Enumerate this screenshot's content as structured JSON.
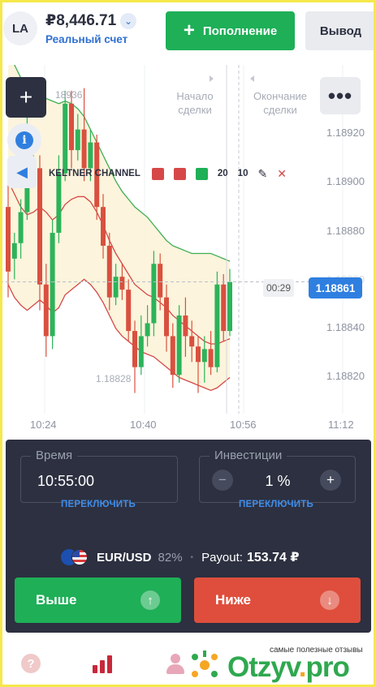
{
  "header": {
    "avatar_initials": "LA",
    "balance": "₽8,446.71",
    "account_type": "Реальный счет",
    "deposit_label": "Пополнение",
    "withdraw_label": "Вывод"
  },
  "chart": {
    "deal_start_label": "Начало\nсделки",
    "deal_end_label": "Окончание\nсделки",
    "current_price": "1.18861",
    "countdown": "00:29",
    "high_label": "18936",
    "low_label": "1.18828",
    "indicator": {
      "name": "KELTNER CHANNEL",
      "param1": "20",
      "param2": "10",
      "colors": [
        "#d64848",
        "#d64848",
        "#1eaf57"
      ]
    }
  },
  "chart_data": {
    "type": "candlestick",
    "y_tick_labels": [
      "1.18920",
      "1.18900",
      "1.18880",
      "1.18860",
      "1.18840",
      "1.18820"
    ],
    "x_tick_labels": [
      "10:24",
      "10:40",
      "10:56",
      "11:12"
    ],
    "ylim": [
      1.1881,
      1.18945
    ],
    "series": [
      {
        "name": "KELTNER CHANNEL",
        "kind": "band"
      }
    ],
    "candles": [
      {
        "o": 1.1889,
        "c": 1.18865,
        "h": 1.189,
        "l": 1.18855
      },
      {
        "o": 1.1887,
        "c": 1.18876,
        "h": 1.1888,
        "l": 1.18862
      },
      {
        "o": 1.18876,
        "c": 1.18888,
        "h": 1.18893,
        "l": 1.1887
      },
      {
        "o": 1.18888,
        "c": 1.18902,
        "h": 1.18935,
        "l": 1.18885
      },
      {
        "o": 1.18902,
        "c": 1.18905,
        "h": 1.1891,
        "l": 1.18898
      },
      {
        "o": 1.18905,
        "c": 1.1886,
        "h": 1.1891,
        "l": 1.1885
      },
      {
        "o": 1.1886,
        "c": 1.1884,
        "h": 1.18868,
        "l": 1.18832
      },
      {
        "o": 1.1884,
        "c": 1.1888,
        "h": 1.18885,
        "l": 1.18835
      },
      {
        "o": 1.1888,
        "c": 1.18903,
        "h": 1.1891,
        "l": 1.18876
      },
      {
        "o": 1.18903,
        "c": 1.1893,
        "h": 1.18935,
        "l": 1.189
      },
      {
        "o": 1.1893,
        "c": 1.18912,
        "h": 1.18935,
        "l": 1.18905
      },
      {
        "o": 1.18912,
        "c": 1.1892,
        "h": 1.18926,
        "l": 1.18908
      },
      {
        "o": 1.1892,
        "c": 1.18905,
        "h": 1.18936,
        "l": 1.189
      },
      {
        "o": 1.18905,
        "c": 1.18915,
        "h": 1.1892,
        "l": 1.189
      },
      {
        "o": 1.18915,
        "c": 1.1889,
        "h": 1.18918,
        "l": 1.18885
      },
      {
        "o": 1.1889,
        "c": 1.18875,
        "h": 1.18895,
        "l": 1.1887
      },
      {
        "o": 1.18875,
        "c": 1.18855,
        "h": 1.1888,
        "l": 1.1885
      },
      {
        "o": 1.18855,
        "c": 1.18863,
        "h": 1.18868,
        "l": 1.18852
      },
      {
        "o": 1.18863,
        "c": 1.18858,
        "h": 1.18868,
        "l": 1.18854
      },
      {
        "o": 1.18858,
        "c": 1.18842,
        "h": 1.18862,
        "l": 1.18838
      },
      {
        "o": 1.18842,
        "c": 1.18828,
        "h": 1.18846,
        "l": 1.18818
      },
      {
        "o": 1.18828,
        "c": 1.1884,
        "h": 1.18848,
        "l": 1.18825
      },
      {
        "o": 1.1884,
        "c": 1.18845,
        "h": 1.18852,
        "l": 1.18836
      },
      {
        "o": 1.18845,
        "c": 1.18868,
        "h": 1.18873,
        "l": 1.1884
      },
      {
        "o": 1.18868,
        "c": 1.18855,
        "h": 1.18872,
        "l": 1.1885
      },
      {
        "o": 1.18855,
        "c": 1.1884,
        "h": 1.1886,
        "l": 1.18834
      },
      {
        "o": 1.1884,
        "c": 1.18825,
        "h": 1.18845,
        "l": 1.1882
      },
      {
        "o": 1.18825,
        "c": 1.18848,
        "h": 1.18852,
        "l": 1.18822
      },
      {
        "o": 1.18848,
        "c": 1.1884,
        "h": 1.18855,
        "l": 1.18832
      },
      {
        "o": 1.1884,
        "c": 1.18836,
        "h": 1.18846,
        "l": 1.1883
      },
      {
        "o": 1.18836,
        "c": 1.1883,
        "h": 1.1884,
        "l": 1.18818
      },
      {
        "o": 1.1883,
        "c": 1.18835,
        "h": 1.1884,
        "l": 1.18822
      },
      {
        "o": 1.18835,
        "c": 1.18828,
        "h": 1.18842,
        "l": 1.18825
      },
      {
        "o": 1.18828,
        "c": 1.1886,
        "h": 1.18865,
        "l": 1.18826
      },
      {
        "o": 1.1886,
        "c": 1.18842,
        "h": 1.18864,
        "l": 1.18838
      },
      {
        "o": 1.18842,
        "c": 1.18861,
        "h": 1.18866,
        "l": 1.1884
      }
    ],
    "upper_band": [
      1.1895,
      1.18945,
      1.1894,
      1.18938,
      1.18936,
      1.18934,
      1.18932,
      1.18931,
      1.1893,
      1.18931,
      1.1893,
      1.18928,
      1.18925,
      1.1892,
      1.18915,
      1.1891,
      1.18905,
      1.189,
      1.18896,
      1.18893,
      1.1889,
      1.18888,
      1.18886,
      1.18883,
      1.1888,
      1.18877,
      1.18875,
      1.18874,
      1.18873,
      1.18872,
      1.18872,
      1.18872,
      1.18872,
      1.18871,
      1.1887,
      1.18869
    ],
    "middle_band": [
      1.189,
      1.18895,
      1.1889,
      1.18887,
      1.18888,
      1.1889,
      1.18888,
      1.18885,
      1.18887,
      1.18891,
      1.18893,
      1.18894,
      1.18894,
      1.18892,
      1.18888,
      1.18883,
      1.18877,
      1.18872,
      1.18868,
      1.18864,
      1.1886,
      1.18858,
      1.18856,
      1.18855,
      1.18853,
      1.18851,
      1.18848,
      1.18846,
      1.18844,
      1.18842,
      1.1884,
      1.18838,
      1.18837,
      1.18837,
      1.18838,
      1.18839
    ],
    "lower_band": [
      1.1886,
      1.18855,
      1.18852,
      1.1885,
      1.18852,
      1.18854,
      1.18852,
      1.18849,
      1.18851,
      1.18856,
      1.18858,
      1.1886,
      1.18862,
      1.1886,
      1.18857,
      1.18853,
      1.18848,
      1.18843,
      1.1884,
      1.18838,
      1.18836,
      1.18834,
      1.18833,
      1.18832,
      1.1883,
      1.18828,
      1.18826,
      1.18824,
      1.18823,
      1.18822,
      1.18821,
      1.1882,
      1.18819,
      1.1882,
      1.18822,
      1.18824
    ]
  },
  "panel": {
    "time_label": "Время",
    "time_value": "10:55:00",
    "time_switch": "ПЕРЕКЛЮЧИТЬ",
    "investment_label": "Инвестиции",
    "investment_value": "1 %",
    "investment_switch": "ПЕРЕКЛЮЧИТЬ",
    "asset": "EUR/USD",
    "asset_percent": "82%",
    "payout_label": "Payout:",
    "payout_value": "153.74 ₽",
    "up_label": "Выше",
    "down_label": "Ниже"
  },
  "nav": {
    "help_icon": "?"
  },
  "watermark": {
    "tagline": "самые полезные отзывы",
    "brand_main": "Otzyv",
    "brand_dot": ".",
    "brand_tld": "pro"
  }
}
